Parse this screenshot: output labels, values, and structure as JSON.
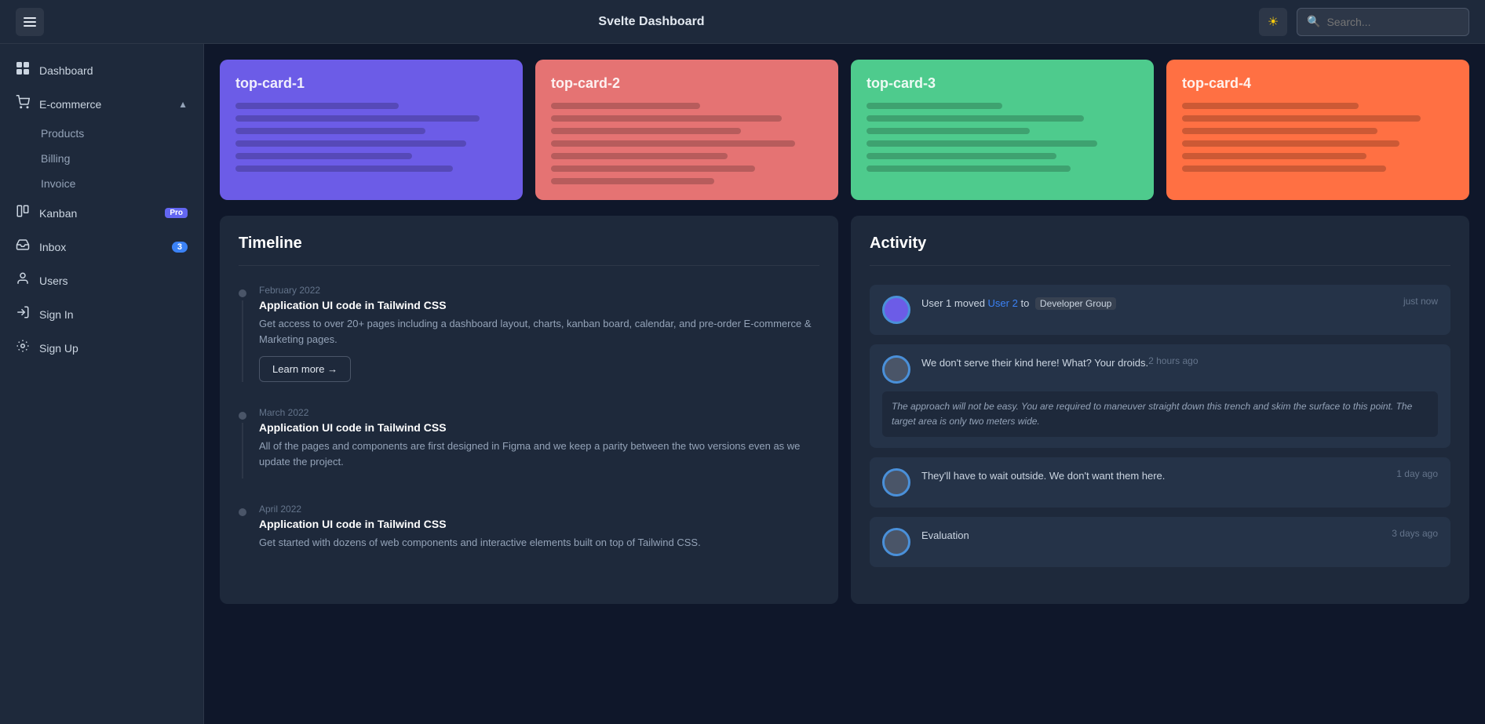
{
  "topbar": {
    "title": "Svelte Dashboard",
    "search_placeholder": "Search...",
    "theme_icon": "☀"
  },
  "sidebar": {
    "items": [
      {
        "id": "dashboard",
        "label": "Dashboard",
        "icon": "⊞",
        "badge": null,
        "pro": false
      },
      {
        "id": "ecommerce",
        "label": "E-commerce",
        "icon": "🛒",
        "badge": null,
        "pro": false,
        "expanded": true
      },
      {
        "id": "products",
        "label": "Products",
        "sub": true
      },
      {
        "id": "billing",
        "label": "Billing",
        "sub": true
      },
      {
        "id": "invoice",
        "label": "Invoice",
        "sub": true
      },
      {
        "id": "kanban",
        "label": "Kanban",
        "icon": "⊟",
        "badge": null,
        "pro": true
      },
      {
        "id": "inbox",
        "label": "Inbox",
        "icon": "⬇",
        "badge": "3",
        "pro": false
      },
      {
        "id": "users",
        "label": "Users",
        "icon": "👤",
        "badge": null,
        "pro": false
      },
      {
        "id": "signin",
        "label": "Sign In",
        "icon": "🔓",
        "badge": null,
        "pro": false
      },
      {
        "id": "signup",
        "label": "Sign Up",
        "icon": "⚙",
        "badge": null,
        "pro": false
      }
    ]
  },
  "top_cards": [
    {
      "id": "card-1",
      "title": "top-card-1",
      "color": "#6c5ce7",
      "lines": [
        60,
        90,
        70,
        85,
        65,
        80
      ]
    },
    {
      "id": "card-2",
      "title": "top-card-2",
      "color": "#e57373",
      "lines": [
        55,
        85,
        70,
        90,
        65,
        75,
        60
      ]
    },
    {
      "id": "card-3",
      "title": "top-card-3",
      "color": "#4ecb8d",
      "lines": [
        50,
        80,
        60,
        85,
        70,
        75
      ]
    },
    {
      "id": "card-4",
      "title": "top-card-4",
      "color": "#ff7043",
      "lines": [
        65,
        88,
        72,
        80,
        68,
        75
      ]
    }
  ],
  "timeline": {
    "title": "Timeline",
    "items": [
      {
        "date": "February 2022",
        "title": "Application UI code in Tailwind CSS",
        "desc": "Get access to over 20+ pages including a dashboard layout, charts, kanban board, calendar, and pre-order E-commerce & Marketing pages.",
        "has_button": true,
        "button_label": "Learn more →"
      },
      {
        "date": "March 2022",
        "title": "Application UI code in Tailwind CSS",
        "desc": "All of the pages and components are first designed in Figma and we keep a parity between the two versions even as we update the project.",
        "has_button": false
      },
      {
        "date": "April 2022",
        "title": "Application UI code in Tailwind CSS",
        "desc": "Get started with dozens of web components and interactive elements built on top of Tailwind CSS.",
        "has_button": false
      }
    ]
  },
  "activity": {
    "title": "Activity",
    "items": [
      {
        "id": "act-1",
        "text_before": "User 1 moved ",
        "user_link": "User 2",
        "text_after": " to ",
        "group": "Developer Group",
        "time": "just now",
        "sub_text": null
      },
      {
        "id": "act-2",
        "text_before": "We don't serve their kind here! What? Your droids.",
        "user_link": null,
        "text_after": null,
        "group": null,
        "time": "2 hours ago",
        "sub_text": "The approach will not be easy. You are required to maneuver straight down this trench and skim the surface to this point. The target area is only two meters wide."
      },
      {
        "id": "act-3",
        "text_before": "They'll have to wait outside. We don't want them here.",
        "user_link": null,
        "text_after": null,
        "group": null,
        "time": "1 day ago",
        "sub_text": null
      },
      {
        "id": "act-4",
        "text_before": "Evaluation",
        "user_link": null,
        "text_after": null,
        "group": null,
        "time": "3 days ago",
        "sub_text": null
      }
    ]
  }
}
